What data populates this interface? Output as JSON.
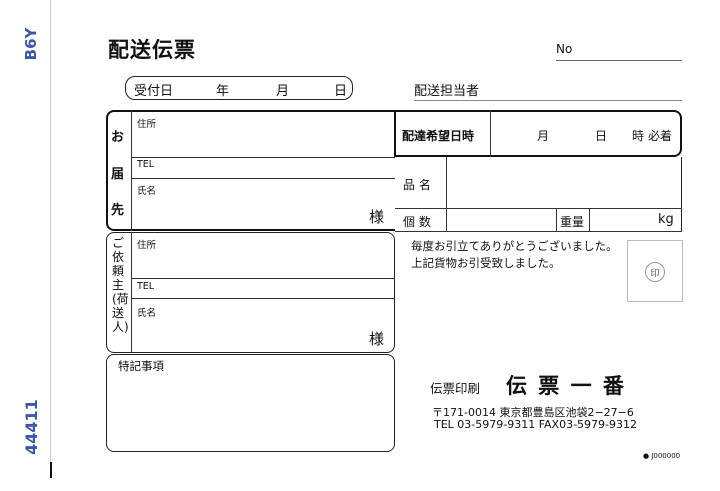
{
  "form": {
    "side_code": "B6Y",
    "side_number": "44411",
    "title": "配送伝票",
    "no_label": "No",
    "date_row": {
      "label": "受付日",
      "year": "年",
      "month": "月",
      "day": "日"
    },
    "staff_label": "配送担当者",
    "recipient": {
      "label_chars": [
        "お",
        "届",
        "先"
      ],
      "address_label": "住所",
      "tel_label": "TEL",
      "name_label": "氏名",
      "honorific": "様"
    },
    "delivery": {
      "label": "配達希望日時",
      "month": "月",
      "day": "日",
      "time": "時",
      "must": "必着"
    },
    "item": {
      "name_label": "品 名",
      "count_label": "個 数",
      "weight_label": "重量",
      "weight_unit": "kg"
    },
    "requester": {
      "label": "ご依頼主(荷送人)",
      "address_label": "住所",
      "tel_label": "TEL",
      "name_label": "氏名",
      "honorific": "様"
    },
    "message": {
      "line1": "毎度お引立てありがとうございました。",
      "line2": "上記貨物お引受致しました。"
    },
    "stamp_char": "印",
    "notes_label": "特記事項",
    "company": {
      "prefix": "伝票印刷",
      "name": "伝 票 一 番",
      "address": "〒171-0014 東京都豊島区池袋2−27−6",
      "phone": "TEL 03-5979-9311 FAX03-5979-9312"
    },
    "code": "● J000000"
  }
}
